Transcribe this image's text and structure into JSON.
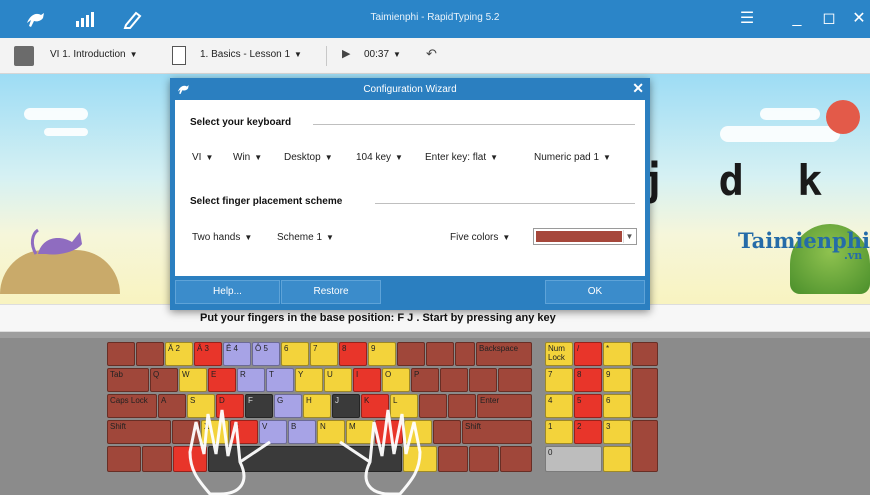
{
  "window": {
    "title": "Taimienphi - RapidTyping 5.2",
    "nav_icons": [
      "kangaroo-icon",
      "statistics-icon",
      "editor-icon"
    ],
    "controls": [
      "menu-icon",
      "minimize-icon",
      "maximize-icon",
      "close-icon"
    ]
  },
  "toolbar": {
    "course": "VI 1. Introduction",
    "lesson": "1. Basics - Lesson 1",
    "time": "00:37"
  },
  "lesson_view": {
    "letters": "j d k f",
    "instruction": "Put your fingers in the base position:  F  J .  Start by pressing any key",
    "logo": "Taimienphi",
    "logo_suffix": ".vn"
  },
  "dialog": {
    "title": "Configuration Wizard",
    "keyboard_section": "Select your keyboard",
    "keyboard_options": [
      "VI",
      "Win",
      "Desktop",
      "104 key",
      "Enter key: flat",
      "Numeric pad 1"
    ],
    "finger_section": "Select finger placement scheme",
    "finger_options": [
      "Two hands",
      "Scheme 1"
    ],
    "color_scheme": "Five colors",
    "selected_color": "#a6473b",
    "buttons": {
      "help": "Help...",
      "restore": "Restore",
      "ok": "OK"
    }
  },
  "keyboard": {
    "row1": [
      "",
      "",
      "Ă 2",
      "Â 3",
      "Ê 4",
      "Ô 5",
      "6",
      "7",
      "8",
      "9",
      "",
      "",
      "",
      "Backspace"
    ],
    "row2": [
      "Tab",
      "Q",
      "W",
      "E",
      "R",
      "T",
      "Y",
      "U",
      "I",
      "O",
      "P",
      "",
      "",
      ""
    ],
    "row3": [
      "Caps Lock",
      "A",
      "S",
      "D",
      "F",
      "G",
      "H",
      "J",
      "K",
      "L",
      "",
      "",
      "Enter"
    ],
    "row4": [
      "Shift",
      "",
      "X",
      "C",
      "V",
      "B",
      "N",
      "M",
      "",
      "",
      "",
      "Shift"
    ],
    "numpad": [
      "Num Lock",
      "/",
      "*",
      "7",
      "8",
      "9",
      "4",
      "5",
      "6",
      "1",
      "2",
      "3",
      "0"
    ]
  },
  "colors": {
    "titlebar": "#2b85c8",
    "dialog": "#2b7fc0",
    "key_brown": "#a0473a",
    "key_red": "#e8352a",
    "key_yellow": "#f3d33b",
    "key_lavender": "#a7a3e6"
  }
}
